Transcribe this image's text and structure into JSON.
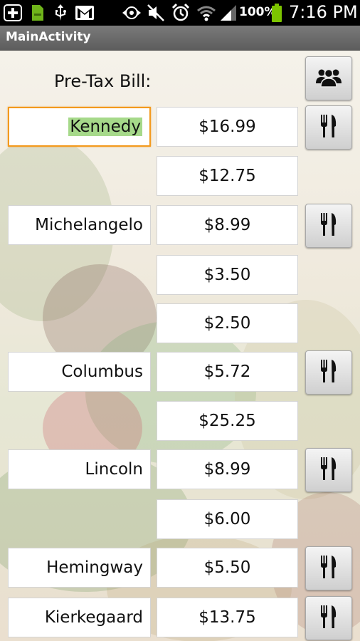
{
  "status_bar": {
    "icons": [
      "add-icon",
      "sd-card-icon",
      "usb-icon",
      "gmail-icon",
      "sync-icon",
      "mute-icon",
      "alarm-icon",
      "wifi-icon",
      "signal-icon",
      "battery-icon"
    ],
    "battery_percent": "100%",
    "time": "7:16 PM"
  },
  "title_bar": {
    "title": "MainActivity"
  },
  "header": {
    "pretax_label": "Pre-Tax Bill:",
    "group_button_icon": "group-icon"
  },
  "rows": [
    {
      "name": "Kennedy",
      "price": "$16.99",
      "has_utensils_button": true,
      "focused": true
    },
    {
      "name": "",
      "price": "$12.75",
      "has_utensils_button": false
    },
    {
      "name": "Michelangelo",
      "price": "$8.99",
      "has_utensils_button": true
    },
    {
      "name": "",
      "price": "$3.50",
      "has_utensils_button": false
    },
    {
      "name": "",
      "price": "$2.50",
      "has_utensils_button": false
    },
    {
      "name": "Columbus",
      "price": "$5.72",
      "has_utensils_button": true
    },
    {
      "name": "",
      "price": "$25.25",
      "has_utensils_button": false
    },
    {
      "name": "Lincoln",
      "price": "$8.99",
      "has_utensils_button": true
    },
    {
      "name": "",
      "price": "$6.00",
      "has_utensils_button": false
    },
    {
      "name": "Hemingway",
      "price": "$5.50",
      "has_utensils_button": true
    },
    {
      "name": "Kierkegaard",
      "price": "$13.75",
      "has_utensils_button": true
    }
  ],
  "colors": {
    "focus_border": "#f39a1d",
    "selection_highlight": "#a6d98a",
    "title_bar": "#6b6b6b",
    "battery_green": "#7cc400"
  }
}
